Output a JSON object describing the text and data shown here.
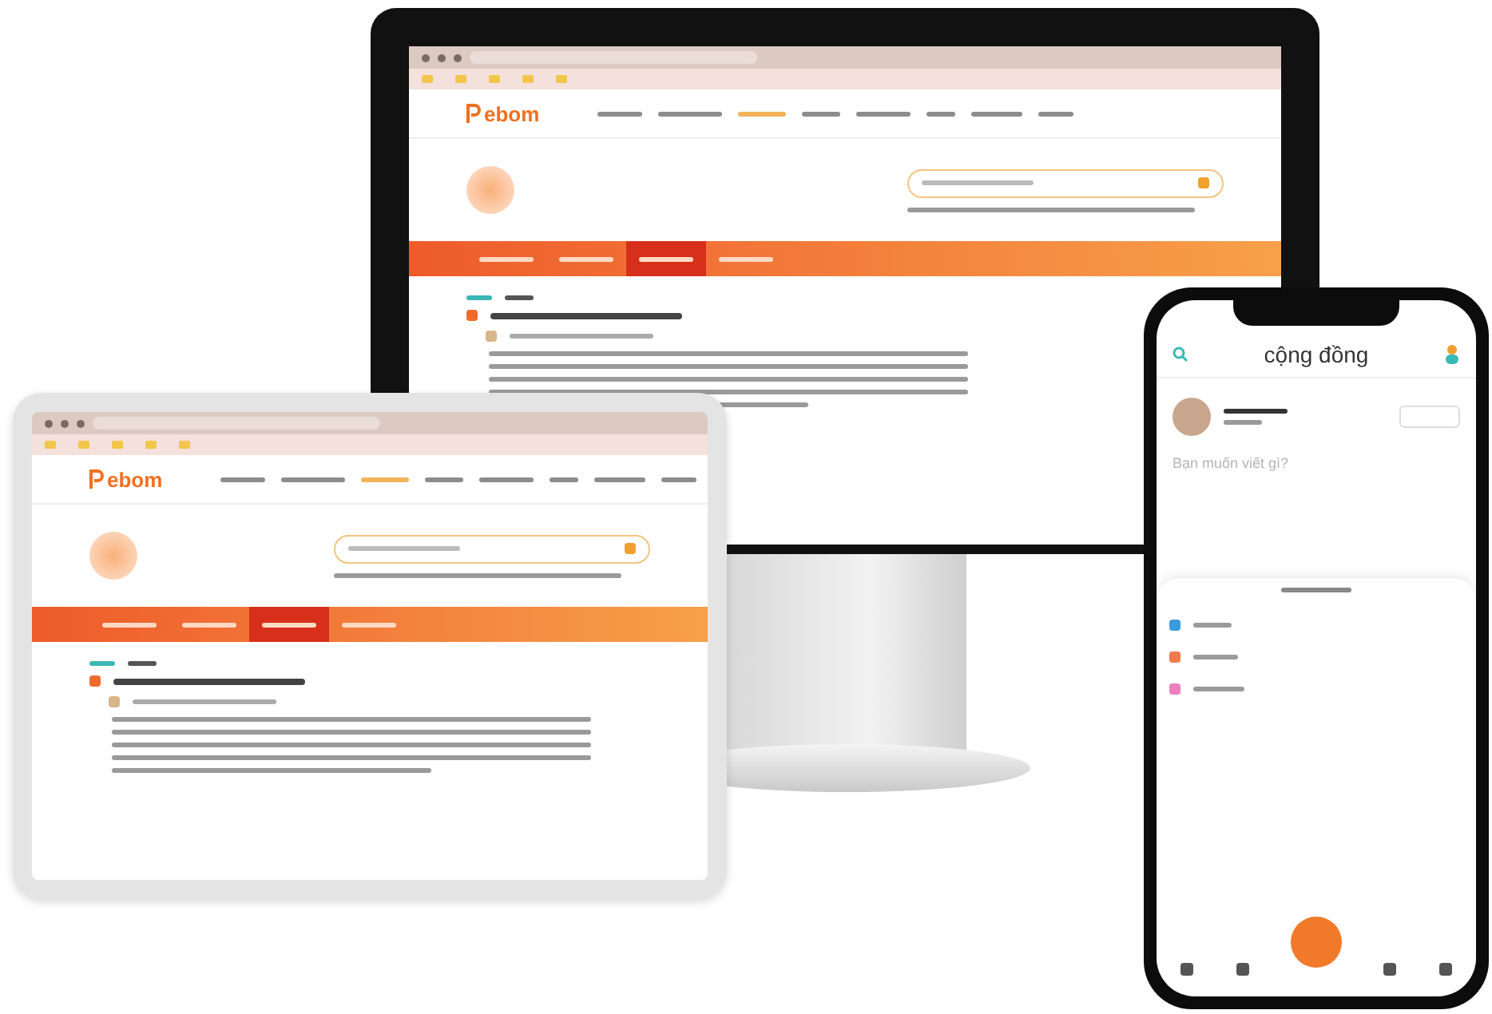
{
  "monitor": {
    "logo": "ebom",
    "nav_items": [
      {
        "selected": false
      },
      {
        "selected": false
      },
      {
        "selected": true
      },
      {
        "selected": false
      }
    ]
  },
  "tablet": {
    "logo": "ebom",
    "nav_items": [
      {
        "selected": false
      },
      {
        "selected": false
      },
      {
        "selected": true
      },
      {
        "selected": false
      }
    ]
  },
  "phone": {
    "title": "cộng đồng",
    "composer": {
      "placeholder": "Bạn muốn viết gì?"
    }
  }
}
